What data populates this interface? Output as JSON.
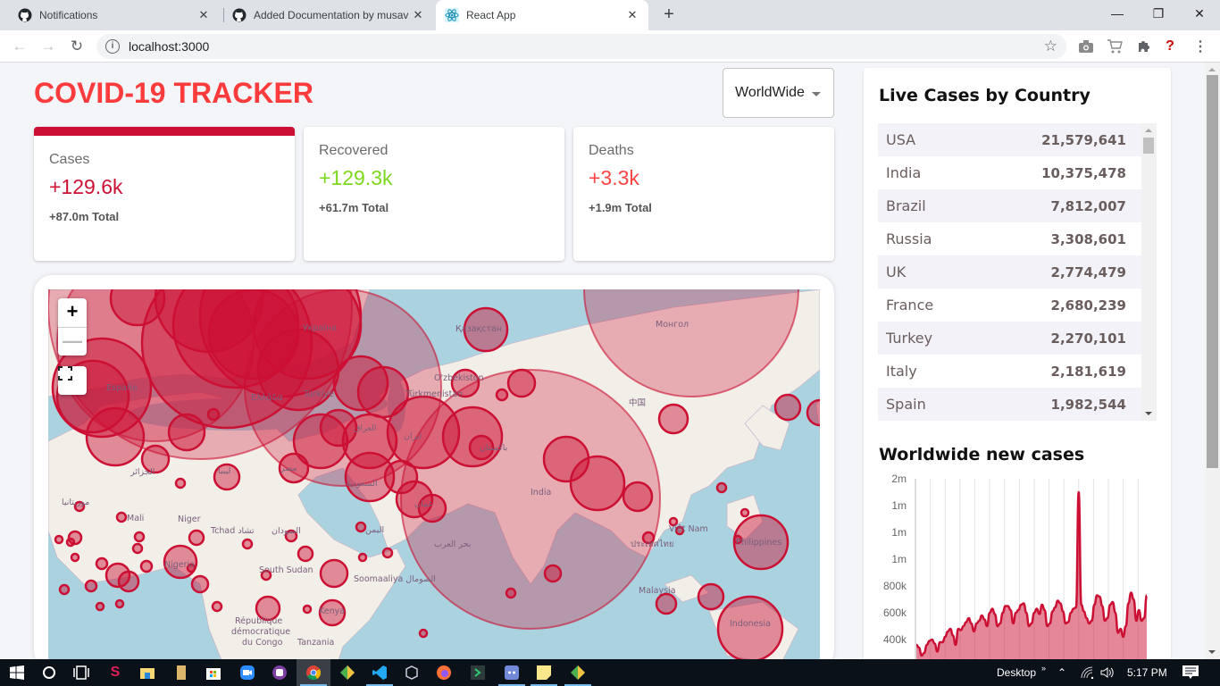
{
  "browser": {
    "tabs": [
      {
        "title": "Notifications",
        "icon": "github-icon",
        "active": false
      },
      {
        "title": "Added Documentation by musav",
        "icon": "github-icon",
        "active": false
      },
      {
        "title": "React App",
        "icon": "react-icon",
        "active": true
      }
    ],
    "new_tab": "+",
    "url": "localhost:3000",
    "window_controls": {
      "minimize": "—",
      "restore": "❐",
      "close": "✕"
    },
    "nav": {
      "back": "←",
      "forward": "→",
      "reload": "↻"
    },
    "extensions": [
      "camera-icon",
      "cart-icon",
      "puzzle-icon",
      "question-icon",
      "menu-icon"
    ]
  },
  "app": {
    "title": "COVID-19 TRACKER",
    "country_select": {
      "selected": "WorldWide"
    },
    "infoboxes": [
      {
        "title": "Cases",
        "cases": "+129.6k",
        "total": "+87.0m Total",
        "color": "#cc1034",
        "selected": true
      },
      {
        "title": "Recovered",
        "cases": "+129.3k",
        "total": "+61.7m Total",
        "color": "#7dd71d",
        "selected": false
      },
      {
        "title": "Deaths",
        "cases": "+3.3k",
        "total": "+1.9m Total",
        "color": "#fb4443",
        "selected": false
      }
    ],
    "map": {
      "zoom_in": "+",
      "zoom_out": "—",
      "labels": [
        "Қазақстан",
        "Монгол",
        "O'zbekiston",
        "Türkmenistan",
        "中国",
        "India",
        "Türkiye",
        "Україна",
        "España",
        "Ελλάδα",
        "Mali",
        "Niger",
        "Tchad تشاد",
        "Nigeria",
        "South Sudan",
        "Soomaaliya الصومال",
        "Kenya",
        "République démocratique du Congo",
        "Tanzania",
        "Việt Nam",
        "ประเทศไทย",
        "Philippines",
        "Malaysia",
        "Indonesia",
        "بحر العرب",
        "باكستان",
        "ایران",
        "العراق",
        "السعودية",
        "مصر",
        "ليبيا",
        "الجزائر",
        "موريتانيا",
        "السودان",
        "اليمن",
        "عمان"
      ]
    },
    "live_cases": {
      "title": "Live Cases by Country",
      "rows": [
        {
          "country": "USA",
          "cases": "21,579,641"
        },
        {
          "country": "India",
          "cases": "10,375,478"
        },
        {
          "country": "Brazil",
          "cases": "7,812,007"
        },
        {
          "country": "Russia",
          "cases": "3,308,601"
        },
        {
          "country": "UK",
          "cases": "2,774,479"
        },
        {
          "country": "France",
          "cases": "2,680,239"
        },
        {
          "country": "Turkey",
          "cases": "2,270,101"
        },
        {
          "country": "Italy",
          "cases": "2,181,619"
        },
        {
          "country": "Spain",
          "cases": "1,982,544"
        }
      ]
    },
    "chart_title": "Worldwide new cases"
  },
  "chart_data": {
    "type": "area",
    "title": "Worldwide new cases",
    "xlabel": "",
    "ylabel": "",
    "y_tick_labels": [
      "2m",
      "1m",
      "1m",
      "1m",
      "800k",
      "600k",
      "400k"
    ],
    "y_ticks": [
      1800000,
      1600000,
      1400000,
      1200000,
      1000000,
      800000,
      600000
    ],
    "ylim": [
      400000,
      1800000
    ],
    "grid": "vertical",
    "x_count": 16,
    "values": [
      560000,
      540000,
      480000,
      500000,
      560000,
      590000,
      600000,
      570000,
      510000,
      580000,
      580000,
      620000,
      660000,
      680000,
      630000,
      560000,
      680000,
      670000,
      700000,
      730000,
      760000,
      720000,
      660000,
      720000,
      740000,
      780000,
      750000,
      700000,
      800000,
      830000,
      790000,
      700000,
      720000,
      800000,
      850000,
      850000,
      820000,
      720000,
      800000,
      820000,
      860000,
      870000,
      800000,
      700000,
      720000,
      800000,
      830000,
      790000,
      860000,
      820000,
      700000,
      720000,
      810000,
      840000,
      890000,
      870000,
      810000,
      720000,
      730000,
      800000,
      830000,
      840000,
      1700000,
      860000,
      810000,
      760000,
      720000,
      740000,
      860000,
      930000,
      920000,
      850000,
      740000,
      760000,
      860000,
      880000,
      800000,
      650000,
      680000,
      620000,
      700000,
      870000,
      950000,
      900000,
      740000,
      820000,
      740000,
      760000,
      930000
    ],
    "line_color": "#cc1034",
    "fill_color": "rgba(204,16,52,0.5)"
  },
  "taskbar": {
    "apps": [
      "windows-start-icon",
      "cortana-icon",
      "task-view-icon",
      "slack-icon",
      "file-explorer-icon",
      "folder-icon",
      "store-icon",
      "zoom-icon",
      "notes-icon",
      "chrome-icon",
      "git-kraken-icon",
      "vscode-icon",
      "virtualbox-icon",
      "firefox-icon",
      "terminal-icon",
      "discord-icon",
      "sticky-notes-icon",
      "git-icon"
    ],
    "desktop_label": "Desktop",
    "time": "5:17 PM"
  }
}
